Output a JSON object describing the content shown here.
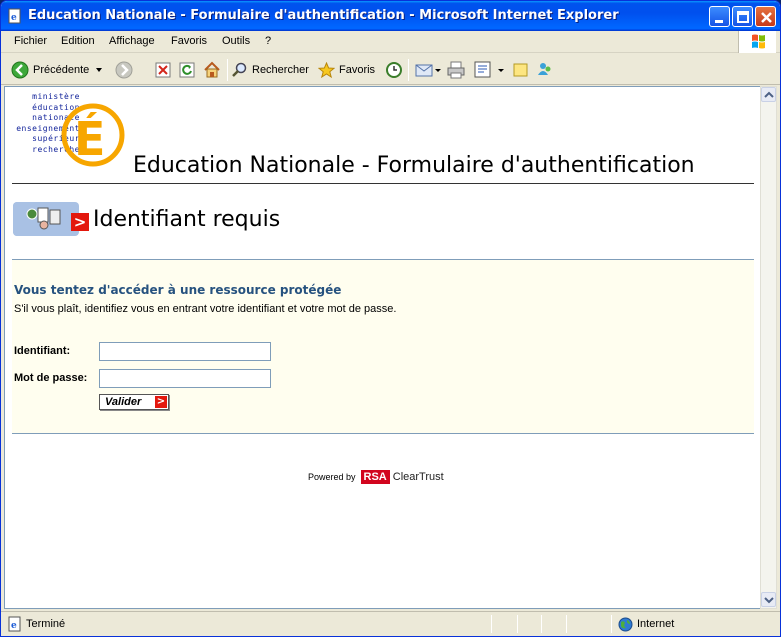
{
  "window": {
    "title": "Education Nationale - Formulaire d'authentification - Microsoft Internet Explorer"
  },
  "menu": {
    "items": [
      "Fichier",
      "Edition",
      "Affichage",
      "Favoris",
      "Outils",
      "?"
    ]
  },
  "toolbar": {
    "back_label": "Précédente",
    "search_label": "Rechercher",
    "favorites_label": "Favoris"
  },
  "page": {
    "logo_lines": [
      "ministère",
      "éducation",
      "nationale",
      "enseignement",
      "supérieur",
      "recherche"
    ],
    "logo_letter": "É",
    "title": "Education Nationale - Formulaire d'authentification",
    "required_title": "Identifiant requis",
    "protected_heading": "Vous tentez d'accéder à une ressource protégée",
    "instructions": "S'il vous plaît, identifiez vous en entrant votre identifiant et votre mot de passe.",
    "username_label": "Identifiant:",
    "username_value": "",
    "password_label": "Mot de passe:",
    "password_value": "",
    "submit_label": "Valider",
    "submit_arrow": ">",
    "required_arrow": ">",
    "powered_by": "Powered by",
    "rsa": "RSA",
    "cleartrust": "ClearTrust"
  },
  "status": {
    "text": "Terminé",
    "zone": "Internet"
  },
  "colors": {
    "titlebar": "#0053ee",
    "heading_blue": "#26527f",
    "accent_red": "#e3170d",
    "form_bg": "#fffeef"
  }
}
